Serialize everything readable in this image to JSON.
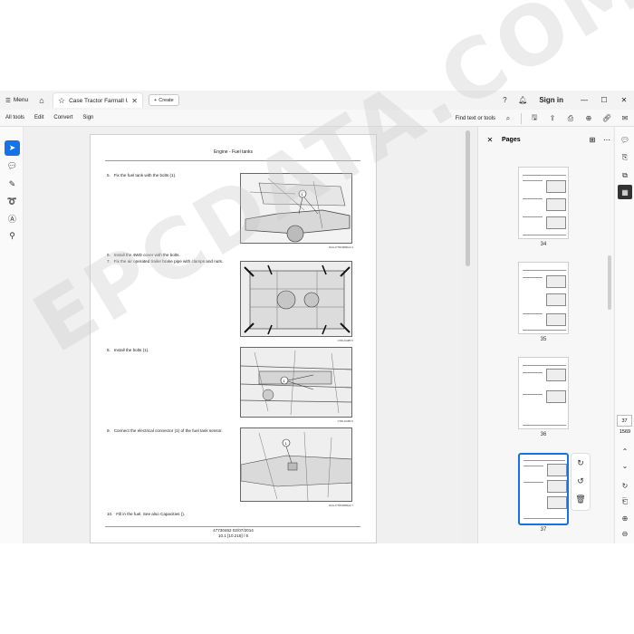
{
  "titlebar": {
    "menu_label": "Menu",
    "tab_title": "Case Tractor Farmall U...",
    "create_label": "Create",
    "signin_label": "Sign in"
  },
  "menubar": {
    "items": [
      "All tools",
      "Edit",
      "Convert",
      "Sign"
    ],
    "find_label": "Find text or tools"
  },
  "document": {
    "header": "Engine - Fuel tanks",
    "steps": [
      {
        "num": "5.",
        "text": "Fix the fuel tank with the bolts (1)."
      },
      {
        "num": "6.",
        "text": "Install the 4WD cover with the bolts."
      },
      {
        "num": "7.",
        "text": "Fix the air operated trailer brake pipe with clamps and nuts."
      },
      {
        "num": "8.",
        "text": "Install the bolts (1)."
      },
      {
        "num": "9.",
        "text": "Connect the electrical connector (1) of the fuel tank sensor."
      },
      {
        "num": "10.",
        "text": "Fill in the fuel. See also Capacities ()."
      }
    ],
    "fig_captions": [
      "RAIL17TR00886AA   4",
      "CTRL01385   5",
      "CTRL01386   6",
      "RAIL17TR00889AA   7"
    ],
    "footer_line1": "47730462 02/07/2014",
    "footer_line2": "10.1 [10.216] / 6"
  },
  "pages_panel": {
    "title": "Pages",
    "thumbnails": [
      "34",
      "35",
      "36",
      "37"
    ]
  },
  "navigation": {
    "current_page": "37",
    "total_pages": "1569"
  },
  "watermark": "EPCDATA.COM"
}
